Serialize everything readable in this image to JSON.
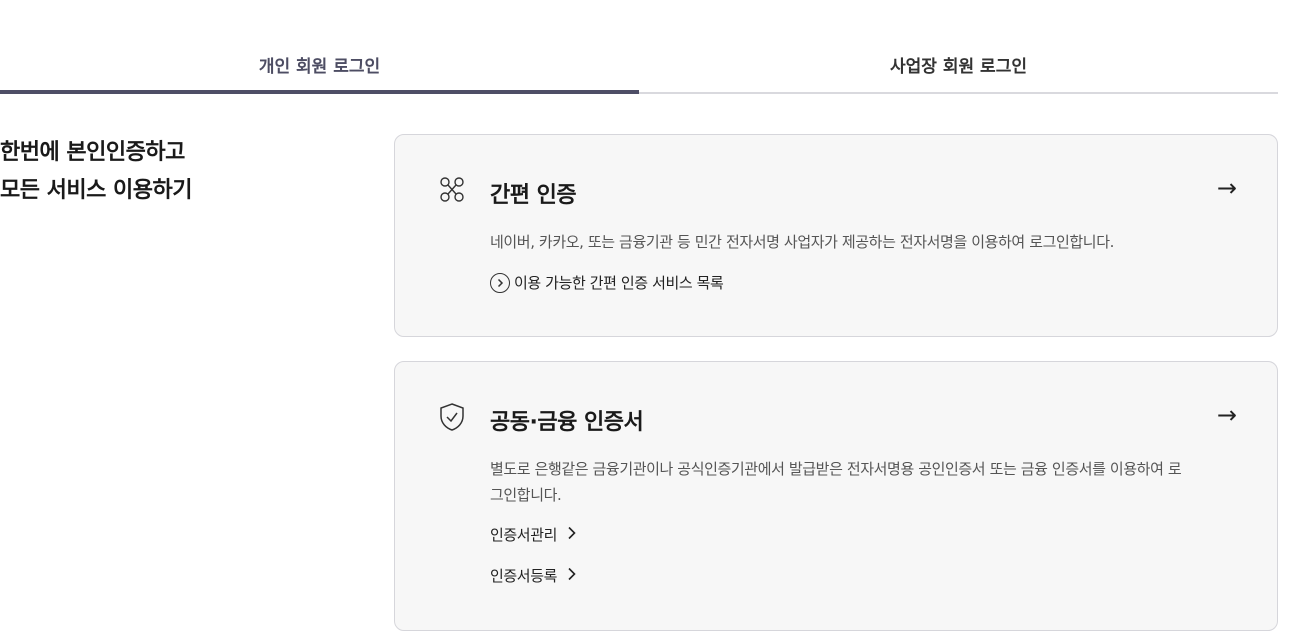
{
  "tabs": [
    {
      "label": "개인 회원 로그인",
      "active": true
    },
    {
      "label": "사업장 회원 로그인",
      "active": false
    }
  ],
  "headline": {
    "line1": "한번에 본인인증하고",
    "line2": "모든 서비스 이용하기"
  },
  "cards": {
    "simple": {
      "icon": "simple-auth-icon",
      "title": "간편 인증",
      "arrow": "→",
      "description": "네이버, 카카오, 또는 금융기관 등 민간 전자서명 사업자가 제공하는 전자서명을 이용하여 로그인합니다.",
      "link_icon": "circle-chevron-right-icon",
      "link_label": "이용 가능한 간편 인증 서비스 목록"
    },
    "certificate": {
      "icon": "shield-check-icon",
      "title": "공동·금융 인증서",
      "arrow": "→",
      "description": "별도로 은행같은 금융기관이나 공식인증기관에서 발급받은 전자서명용 공인인증서 또는 금융 인증서를 이용하여 로그인합니다.",
      "links": [
        {
          "label": "인증서관리",
          "icon": "chevron-right-icon"
        },
        {
          "label": "인증서등록",
          "icon": "chevron-right-icon"
        }
      ]
    }
  },
  "colors": {
    "tab_active_bar": "#4e4e66",
    "card_background": "#f7f7f7",
    "card_border": "#d6d6db"
  }
}
